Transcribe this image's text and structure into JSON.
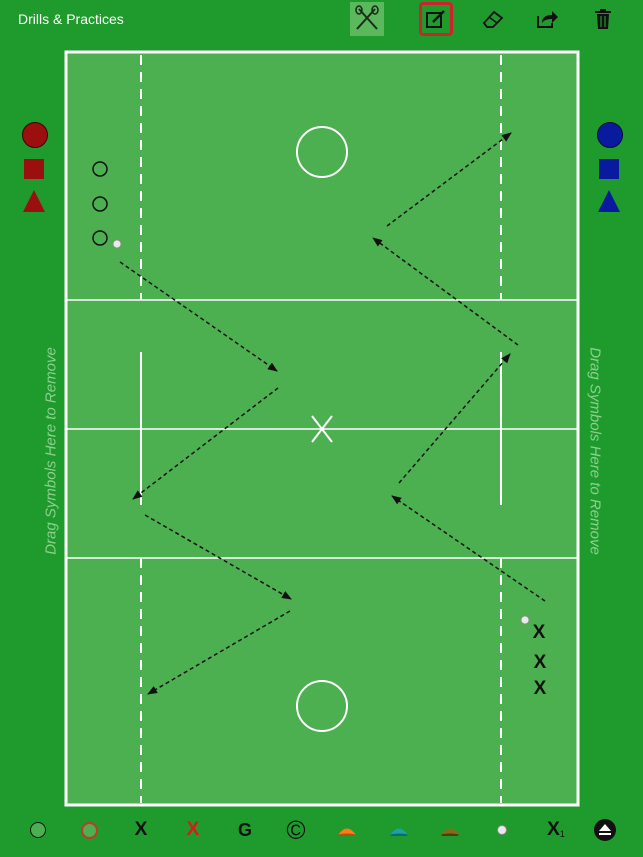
{
  "app": {
    "title": "Drills & Practices"
  },
  "toolbar": {
    "items": [
      {
        "name": "stick-tool",
        "selected": true
      },
      {
        "name": "edit-tool",
        "outlined": true
      },
      {
        "name": "eraser-tool"
      },
      {
        "name": "share-tool"
      },
      {
        "name": "trash-tool"
      }
    ]
  },
  "sides": {
    "left_remove_hint": "Drag Symbols Here to Remove",
    "right_remove_hint": "Drag Symbols Here to Remove",
    "left_color": "#9b0f0f",
    "right_color": "#0a1a9e"
  },
  "field_markers": {
    "attackers": [
      "X",
      "X",
      "X"
    ]
  },
  "bottom_bar": {
    "x_black": "X",
    "x_red": "X",
    "goalie": "G",
    "copyright": "©",
    "x_sub_main": "X",
    "x_sub_index": "1"
  },
  "colors": {
    "background": "#1f9a2c",
    "field": "#4caf50",
    "accent_red": "#c9262b"
  }
}
